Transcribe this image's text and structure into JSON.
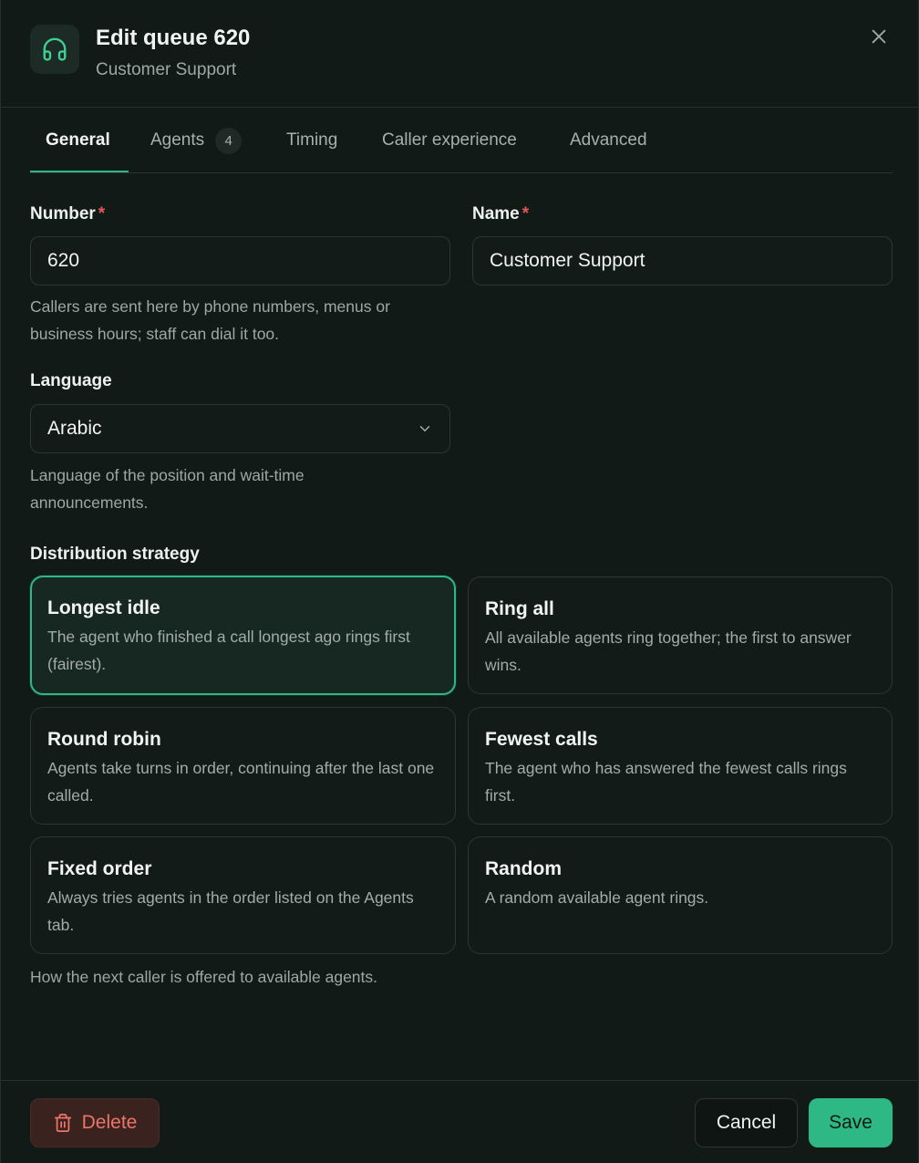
{
  "header": {
    "title": "Edit queue 620",
    "subtitle": "Customer Support",
    "icon": "headphones-icon",
    "close_icon": "close-icon"
  },
  "tabs": [
    {
      "label": "General",
      "active": true
    },
    {
      "label": "Agents",
      "badge": "4",
      "active": false
    },
    {
      "label": "Timing",
      "active": false
    },
    {
      "label": "Caller experience",
      "active": false
    },
    {
      "label": "Advanced",
      "active": false
    }
  ],
  "form": {
    "number": {
      "label": "Number",
      "required_mark": "*",
      "value": "620",
      "helper": "Callers are sent here by phone numbers, menus or business hours; staff can dial it too."
    },
    "name": {
      "label": "Name",
      "required_mark": "*",
      "value": "Customer Support"
    },
    "language": {
      "label": "Language",
      "value": "Arabic",
      "helper": "Language of the position and wait-time announcements."
    },
    "distribution": {
      "label": "Distribution strategy",
      "helper": "How the next caller is offered to available agents.",
      "options": [
        {
          "title": "Longest idle",
          "description": "The agent who finished a call longest ago rings first (fairest).",
          "selected": true
        },
        {
          "title": "Ring all",
          "description": "All available agents ring together; the first to answer wins.",
          "selected": false
        },
        {
          "title": "Round robin",
          "description": "Agents take turns in order, continuing after the last one called.",
          "selected": false
        },
        {
          "title": "Fewest calls",
          "description": "The agent who has answered the fewest calls rings first.",
          "selected": false
        },
        {
          "title": "Fixed order",
          "description": "Always tries agents in the order listed on the Agents tab.",
          "selected": false
        },
        {
          "title": "Random",
          "description": "A random available agent rings.",
          "selected": false
        }
      ]
    }
  },
  "footer": {
    "delete_label": "Delete",
    "cancel_label": "Cancel",
    "save_label": "Save"
  },
  "colors": {
    "accent": "#2eb886",
    "danger": "#ec7568",
    "background": "#121a17"
  }
}
